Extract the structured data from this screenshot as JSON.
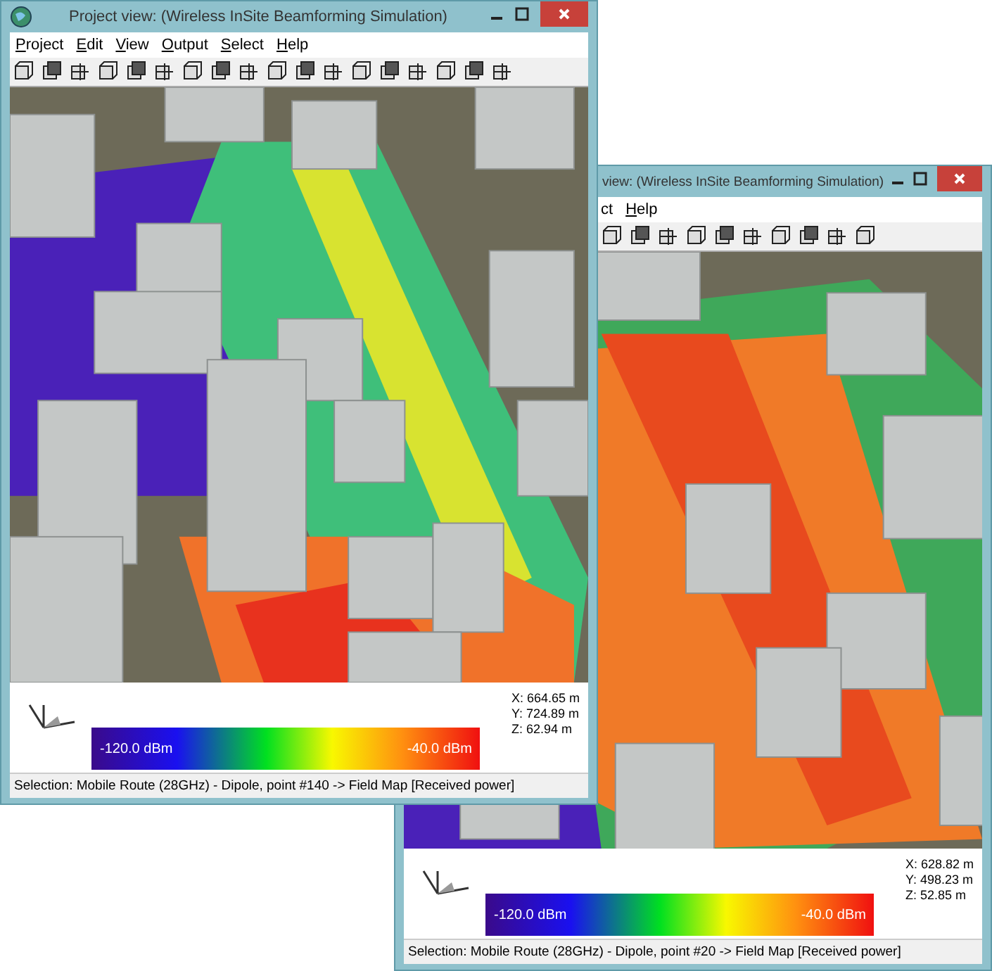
{
  "windows": [
    {
      "title": "Project view: (Wireless InSite Beamforming Simulation)",
      "menu": [
        {
          "label": "Project",
          "accel": true
        },
        {
          "label": "Edit",
          "accel": true
        },
        {
          "label": "View",
          "accel": true
        },
        {
          "label": "Output",
          "accel": true
        },
        {
          "label": "Select",
          "accel": true
        },
        {
          "label": "Help",
          "accel": true
        }
      ],
      "legend": {
        "min_label": "-120.0 dBm",
        "max_label": "-40.0 dBm"
      },
      "coords": [
        "X: 664.65 m",
        "Y: 724.89 m",
        "Z: 62.94 m"
      ],
      "status": "Selection: Mobile Route (28GHz) - Dipole, point #140 -> Field Map [Received power]"
    },
    {
      "title": "view: (Wireless InSite Beamforming Simulation)",
      "menu": [
        {
          "label": "ct",
          "accel": false
        },
        {
          "label": "Help",
          "accel": true
        }
      ],
      "legend": {
        "min_label": "-120.0 dBm",
        "max_label": "-40.0 dBm"
      },
      "coords": [
        "X: 628.82 m",
        "Y: 498.23 m",
        "Z: 52.85 m"
      ],
      "status": "Selection: Mobile Route (28GHz) - Dipole, point #20 -> Field Map [Received power]"
    }
  ]
}
